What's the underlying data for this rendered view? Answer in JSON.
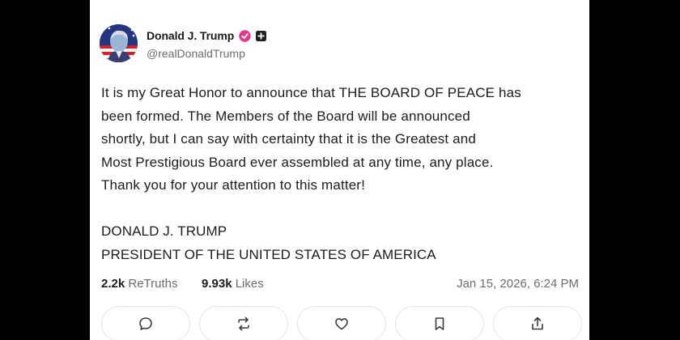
{
  "post": {
    "author": {
      "display_name": "Donald J. Trump",
      "handle": "@realDonaldTrump",
      "avatar": "avatar-flag-portrait",
      "verified_icon": "verified-check-icon",
      "verified_color": "#e03b8b",
      "badge_icon": "plus-badge-icon"
    },
    "body_lines": [
      "It is my Great Honor to announce that THE BOARD OF PEACE has",
      "been formed. The Members of the Board will be announced",
      "shortly, but I can say with certainty that it is the Greatest and",
      "Most Prestigious Board ever assembled at any time, any place.",
      "Thank you for your attention to this matter!"
    ],
    "signature": {
      "line1": "DONALD J. TRUMP",
      "line2": "PRESIDENT OF THE UNITED STATES OF AMERICA"
    },
    "stats": {
      "retruths_count": "2.2k",
      "retruths_label": "ReTruths",
      "likes_count": "9.93k",
      "likes_label": "Likes",
      "timestamp": "Jan 15, 2026, 6:24 PM"
    },
    "actions": [
      {
        "icon": "reply-icon"
      },
      {
        "icon": "retruth-icon"
      },
      {
        "icon": "like-icon"
      },
      {
        "icon": "bookmark-icon"
      },
      {
        "icon": "share-icon"
      }
    ]
  },
  "colors": {
    "text": "#1c1c1c",
    "muted": "#6c6c72",
    "border": "#e4e4e7",
    "frame": "#000000"
  }
}
